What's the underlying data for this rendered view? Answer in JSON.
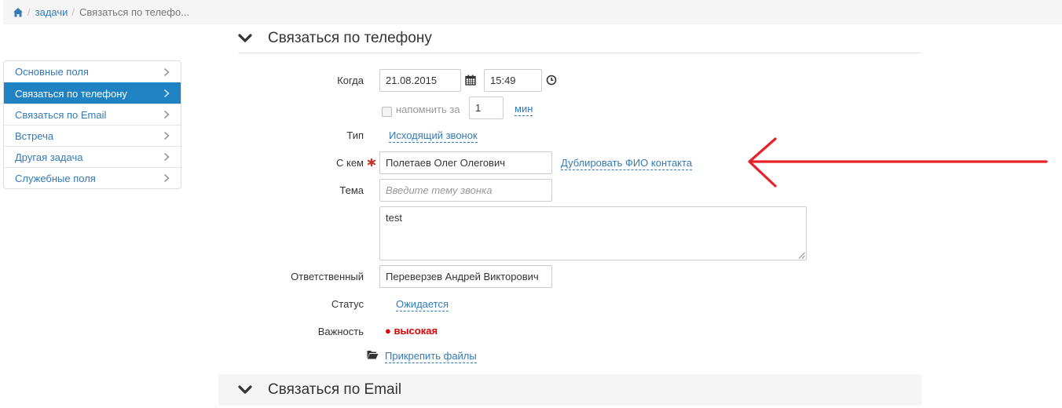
{
  "breadcrumb": {
    "home_icon": "home-icon",
    "link": "задачи",
    "current": "Связаться по телефо..."
  },
  "sections": {
    "phone_title": "Связаться по телефону",
    "email_title": "Связаться по Email"
  },
  "sidebar": {
    "items": [
      {
        "label": "Основные поля",
        "active": false
      },
      {
        "label": "Связаться по телефону",
        "active": true
      },
      {
        "label": "Связаться по Email",
        "active": false
      },
      {
        "label": "Встреча",
        "active": false
      },
      {
        "label": "Другая задача",
        "active": false
      },
      {
        "label": "Служебные поля",
        "active": false
      }
    ]
  },
  "form": {
    "when_label": "Когда",
    "date_value": "21.08.2015",
    "time_value": "15:49",
    "remind_label": "напомнить за",
    "remind_value": "1",
    "remind_unit": "мин",
    "type_label": "Тип",
    "type_value": "Исходящий звонок",
    "with_label": "С кем",
    "with_value": "Полетаев Олег Олегович",
    "duplicate_link": "Дублировать ФИО контакта",
    "subject_label": "Тема",
    "subject_placeholder": "Введите тему звонка",
    "notes_value": "test",
    "responsible_label": "Ответственный",
    "responsible_value": "Переверзев Андрей Викторович",
    "status_label": "Статус",
    "status_value": "Ожидается",
    "importance_label": "Важность",
    "importance_value": "● высокая",
    "attach_link": "Прикрепить файлы"
  },
  "colors": {
    "accent": "#1f83c3",
    "link": "#337ab7",
    "required": "#c0392b",
    "importance": "#e60000",
    "annotation_arrow": "#e8202a"
  }
}
